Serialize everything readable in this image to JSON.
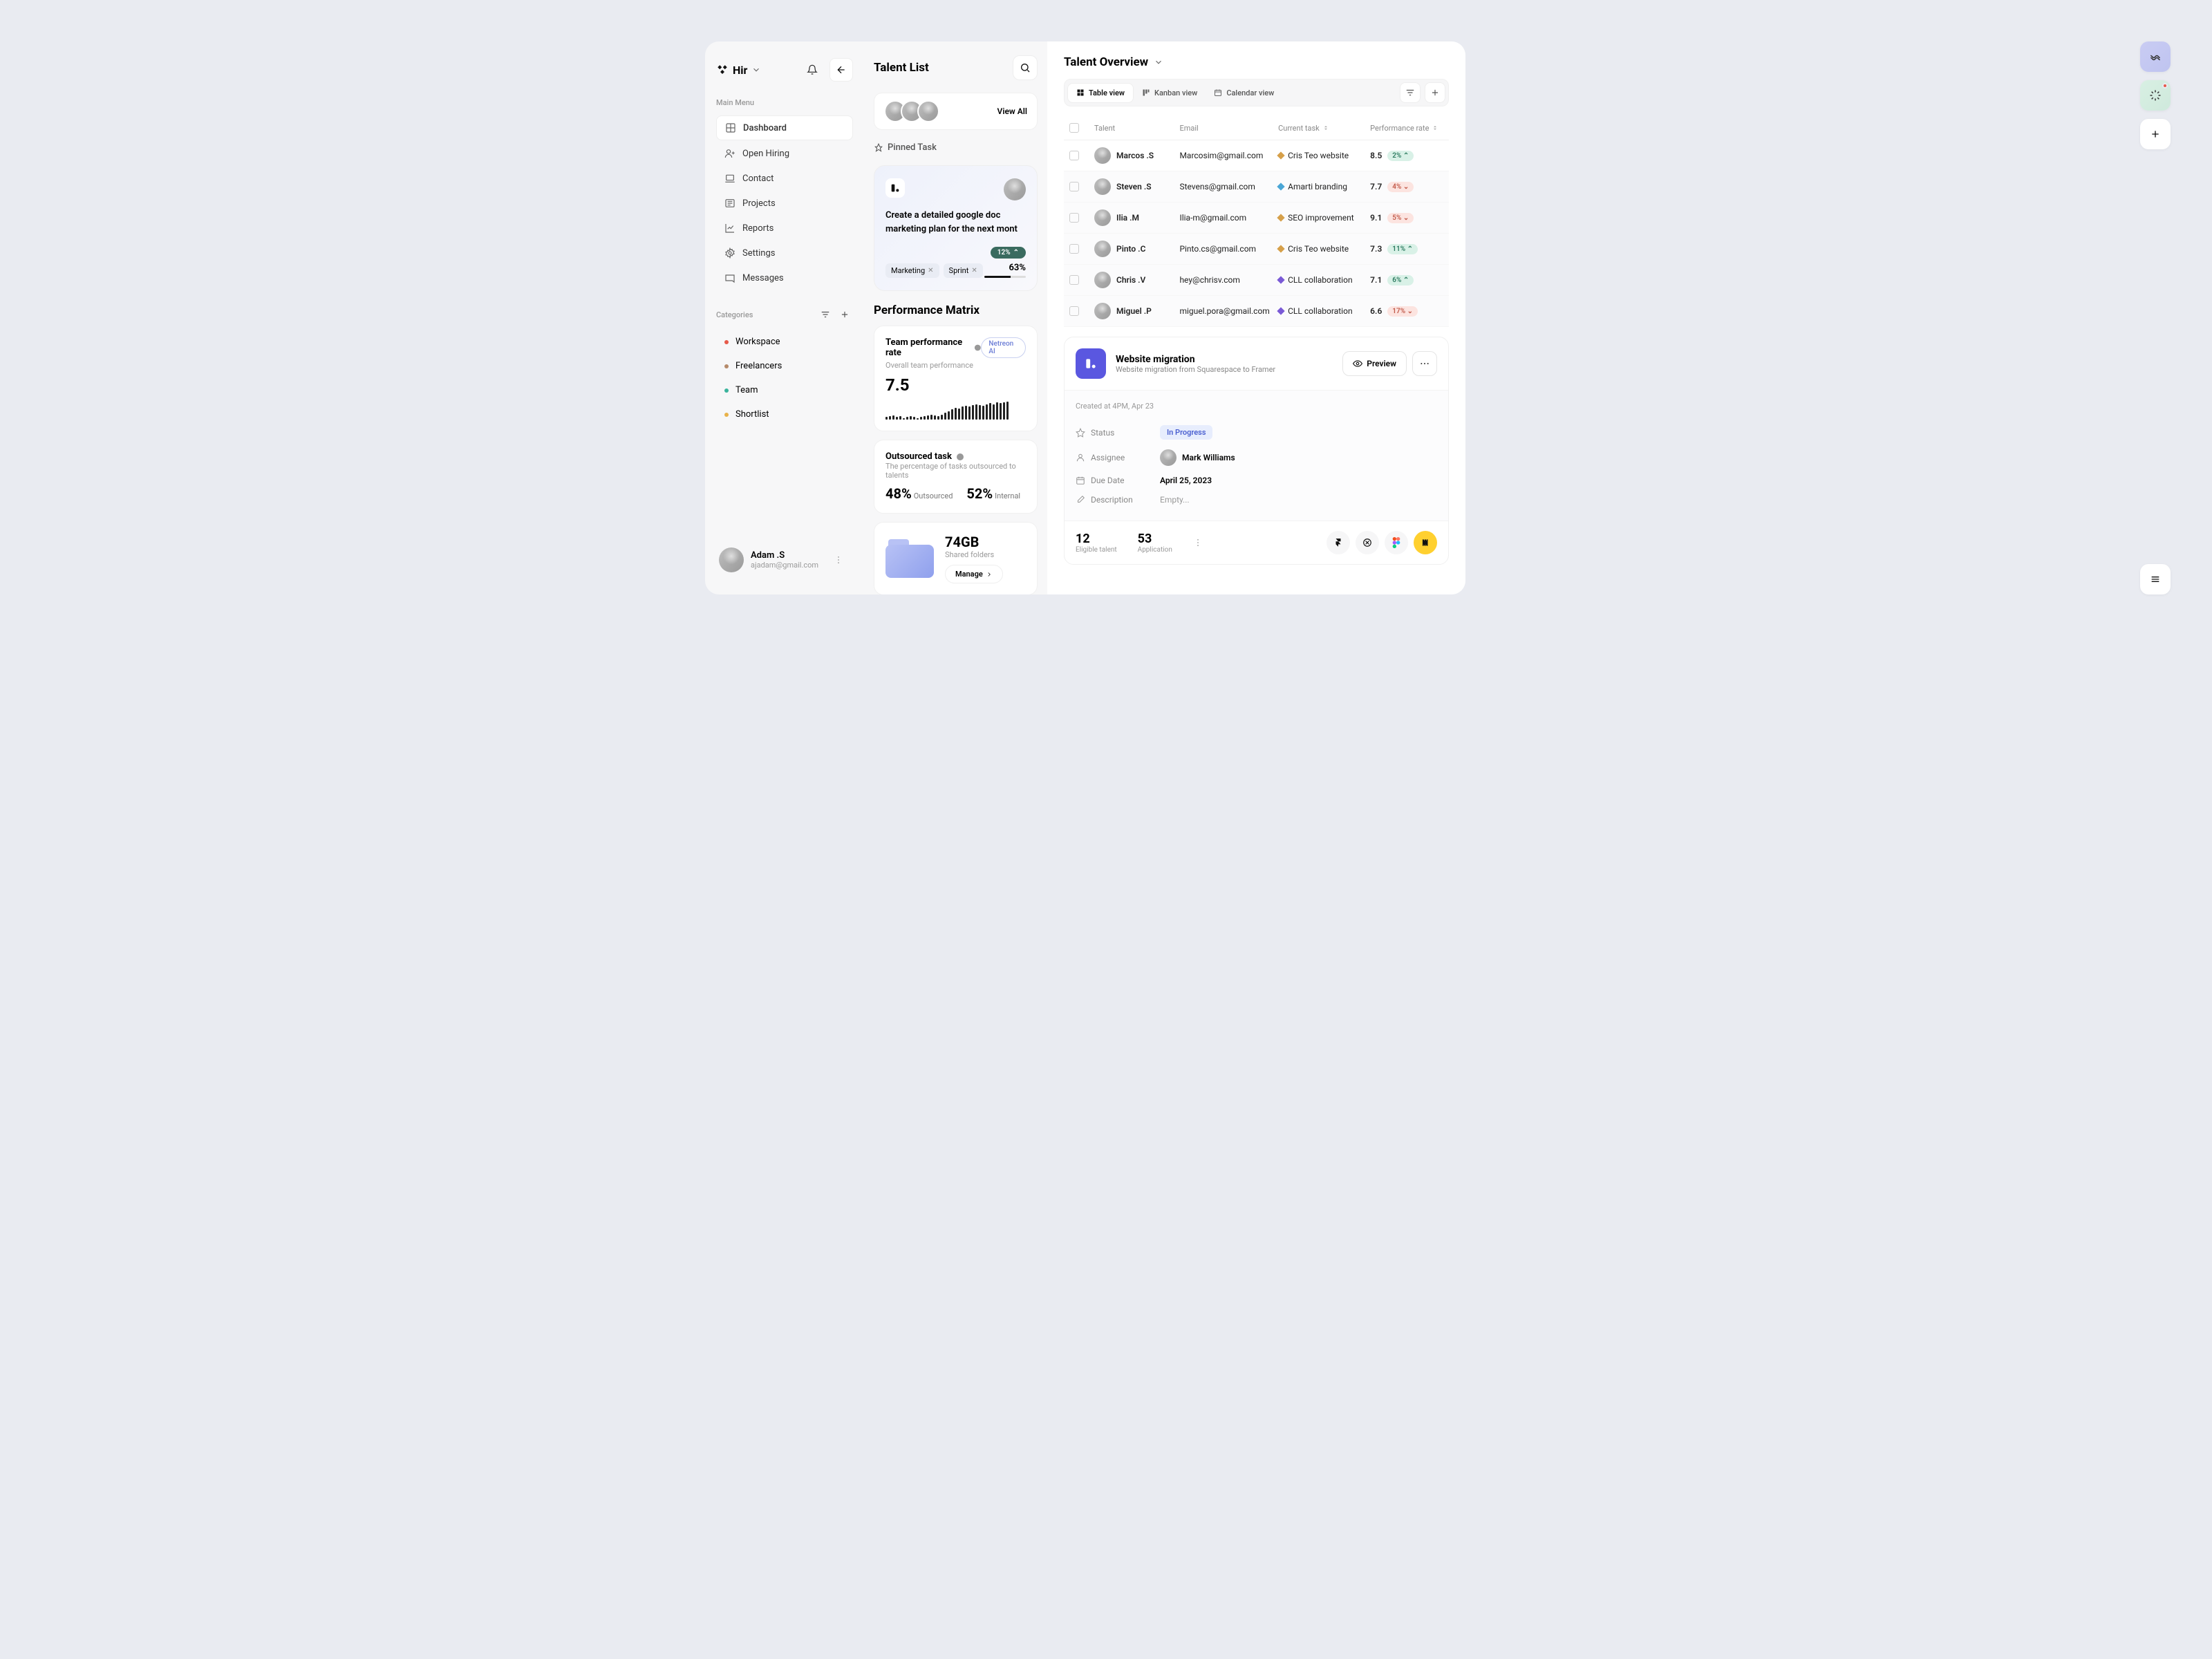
{
  "brand": "Hir",
  "sidebar": {
    "sections": {
      "main": "Main Menu",
      "categories": "Categories"
    },
    "nav": [
      {
        "label": "Dashboard",
        "icon": "grid"
      },
      {
        "label": "Open Hiring",
        "icon": "user-plus"
      },
      {
        "label": "Contact",
        "icon": "laptop"
      },
      {
        "label": "Projects",
        "icon": "list"
      },
      {
        "label": "Reports",
        "icon": "chart"
      },
      {
        "label": "Settings",
        "icon": "gear"
      },
      {
        "label": "Messages",
        "icon": "message"
      }
    ],
    "categories": [
      {
        "label": "Workspace",
        "color": "#e65a4a"
      },
      {
        "label": "Freelancers",
        "color": "#b58a6a"
      },
      {
        "label": "Team",
        "color": "#3ab39c"
      },
      {
        "label": "Shortlist",
        "color": "#e8b24a"
      }
    ]
  },
  "user": {
    "name": "Adam .S",
    "email": "ajadam@gmail.com"
  },
  "talent_list": {
    "title": "Talent List",
    "view_all": "View All",
    "pinned_label": "Pinned Task",
    "pinned": {
      "desc": "Create a detailed google doc marketing plan for the next mont",
      "tags": [
        "Marketing",
        "Sprint"
      ],
      "trend": "12%",
      "progress_label": "63%",
      "progress": 63
    }
  },
  "performance": {
    "title": "Performance Matrix",
    "team": {
      "title": "Team performance rate",
      "subtitle": "Overall team performance",
      "value": "7.5",
      "ai_badge": "Netreon AI"
    },
    "outsourced": {
      "title": "Outsourced task",
      "subtitle": "The percentage of tasks outsourced to talents",
      "a_value": "48%",
      "a_label": "Outsourced",
      "b_value": "52%",
      "b_label": "Internal"
    },
    "storage": {
      "value": "74GB",
      "label": "Shared folders",
      "manage": "Manage"
    }
  },
  "overview": {
    "title": "Talent Overview",
    "views": [
      "Table view",
      "Kanban view",
      "Calendar view"
    ],
    "columns": [
      "Talent",
      "Email",
      "Current task",
      "Performance rate"
    ],
    "rows": [
      {
        "name": "Marcos .S",
        "email": "Marcosim@gmail.com",
        "task": "Cris Teo website",
        "task_color": "#d6a04a",
        "rate": "8.5",
        "delta": "2%",
        "dir": "up"
      },
      {
        "name": "Steven .S",
        "email": "Stevens@gmail.com",
        "task": "Amarti branding",
        "task_color": "#4aa6d6",
        "rate": "7.7",
        "delta": "4%",
        "dir": "down"
      },
      {
        "name": "Ilia .M",
        "email": "Ilia-m@gmail.com",
        "task": "SEO improvement",
        "task_color": "#d6a04a",
        "rate": "9.1",
        "delta": "5%",
        "dir": "down"
      },
      {
        "name": "Pinto .C",
        "email": "Pinto.cs@gmail.com",
        "task": "Cris Teo website",
        "task_color": "#d6a04a",
        "rate": "7.3",
        "delta": "11%",
        "dir": "up"
      },
      {
        "name": "Chris .V",
        "email": "hey@chrisv.com",
        "task": "CLL collaboration",
        "task_color": "#7a5ad6",
        "rate": "7.1",
        "delta": "6%",
        "dir": "up"
      },
      {
        "name": "Miguel .P",
        "email": "miguel.pora@gmail.com",
        "task": "CLL collaboration",
        "task_color": "#7a5ad6",
        "rate": "6.6",
        "delta": "17%",
        "dir": "down"
      }
    ]
  },
  "detail": {
    "title": "Website migration",
    "subtitle": "Website migration from Squarespace to Framer",
    "preview": "Preview",
    "created": "Created at 4PM, Apr 23",
    "meta": {
      "status_label": "Status",
      "status": "In Progress",
      "assignee_label": "Assignee",
      "assignee": "Mark Williams",
      "due_label": "Due Date",
      "due": "April 25, 2023",
      "desc_label": "Description",
      "desc": "Empty..."
    },
    "stats": [
      {
        "value": "12",
        "label": "Eligible talent"
      },
      {
        "value": "53",
        "label": "Application"
      }
    ]
  },
  "chart_data": {
    "type": "bar",
    "title": "Team performance rate",
    "values": [
      3,
      4,
      5,
      3,
      4,
      2,
      3,
      4,
      3,
      2,
      3,
      4,
      5,
      6,
      5,
      4,
      6,
      8,
      10,
      12,
      14,
      13,
      15,
      16,
      15,
      17,
      18,
      17,
      16,
      18,
      19,
      18,
      20,
      19,
      20,
      21
    ],
    "ylim": [
      0,
      24
    ]
  }
}
